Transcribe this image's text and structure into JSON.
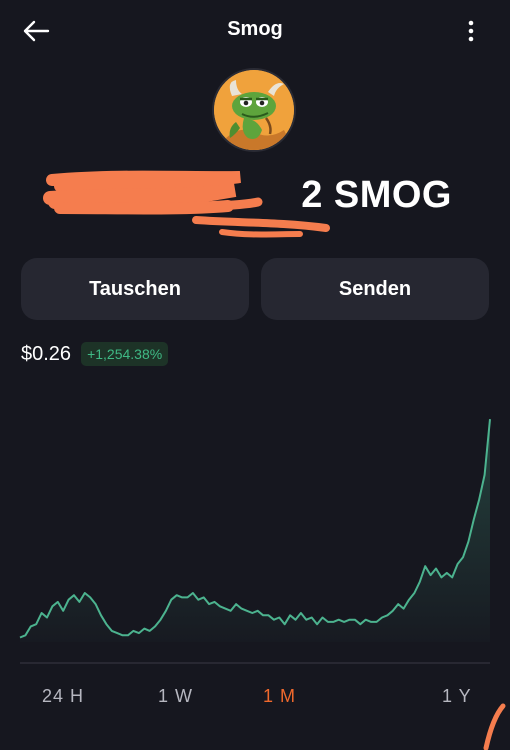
{
  "header": {
    "title": "Smog",
    "back_icon": "arrow-left-icon",
    "menu_icon": "more-vertical-icon"
  },
  "token": {
    "logo_icon": "smog-dragon-logo",
    "balance_visible": "2 SMOG"
  },
  "actions": {
    "swap_label": "Tauschen",
    "send_label": "Senden"
  },
  "price": {
    "value": "$0.26",
    "change": "+1,254.38%",
    "change_color": "#3fb985"
  },
  "chart_data": {
    "type": "area",
    "values": [
      0.02,
      0.03,
      0.07,
      0.08,
      0.13,
      0.11,
      0.16,
      0.18,
      0.14,
      0.19,
      0.21,
      0.18,
      0.22,
      0.2,
      0.17,
      0.12,
      0.08,
      0.05,
      0.04,
      0.03,
      0.03,
      0.05,
      0.04,
      0.06,
      0.05,
      0.07,
      0.1,
      0.14,
      0.19,
      0.21,
      0.2,
      0.2,
      0.22,
      0.19,
      0.2,
      0.17,
      0.18,
      0.16,
      0.15,
      0.14,
      0.17,
      0.15,
      0.14,
      0.13,
      0.14,
      0.12,
      0.12,
      0.1,
      0.11,
      0.08,
      0.12,
      0.1,
      0.13,
      0.1,
      0.11,
      0.08,
      0.11,
      0.09,
      0.09,
      0.1,
      0.09,
      0.1,
      0.1,
      0.08,
      0.1,
      0.09,
      0.09,
      0.11,
      0.12,
      0.14,
      0.17,
      0.15,
      0.19,
      0.22,
      0.27,
      0.34,
      0.3,
      0.33,
      0.29,
      0.31,
      0.29,
      0.35,
      0.38,
      0.45,
      0.55,
      0.64,
      0.75,
      1.0
    ],
    "line_color": "#4cb38f",
    "ylim": [
      0,
      1.05
    ]
  },
  "ranges": {
    "items": [
      "24 H",
      "1 W",
      "1 M",
      "1 Y"
    ],
    "active": "1 M",
    "active_color": "#f0692d"
  }
}
